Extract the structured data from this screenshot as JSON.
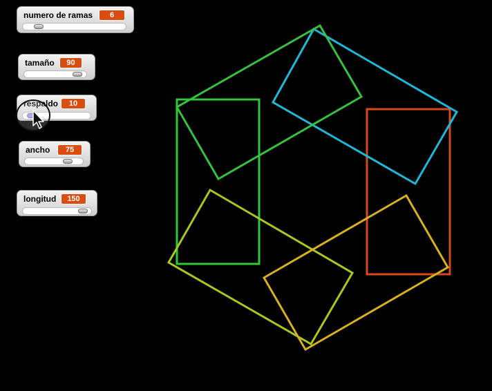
{
  "watchers": [
    {
      "label": "numero de ramas",
      "value": "6"
    },
    {
      "label": "tamaño",
      "value": "90"
    },
    {
      "label": "respaldo",
      "value": "10"
    },
    {
      "label": "ancho",
      "value": "75"
    },
    {
      "label": "longitud",
      "value": "150"
    }
  ],
  "colors": {
    "background": "#000000",
    "value_badge": "#d94d10",
    "shape_orange": "#d84a1c",
    "shape_blue": "#20b8d8",
    "shape_green_top": "#38c040",
    "shape_green_left": "#2ec838",
    "shape_yellow_green": "#a8c820",
    "shape_yellow": "#d8b020"
  }
}
